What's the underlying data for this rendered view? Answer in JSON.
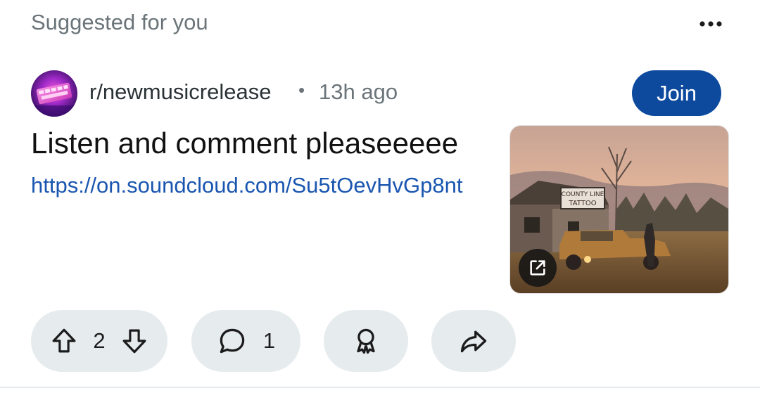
{
  "header": {
    "suggested_label": "Suggested for you",
    "more_icon": "more-horizontal-icon"
  },
  "post": {
    "subreddit": "r/newmusicrelease",
    "separator": "•",
    "time_ago": "13h ago",
    "join_label": "Join",
    "title": "Listen and comment pleaseeeee",
    "link": "https://on.soundcloud.com/Su5tOevHvGp8nt",
    "thumbnail_icon": "external-link-icon"
  },
  "actions": {
    "upvote_icon": "upvote-icon",
    "vote_count": "2",
    "downvote_icon": "downvote-icon",
    "comment_icon": "comment-icon",
    "comment_count": "1",
    "award_icon": "award-icon",
    "share_icon": "share-icon"
  },
  "colors": {
    "join_button": "#0d4a9e",
    "link": "#1a56b0",
    "pill_background": "#e6ebee",
    "muted_text": "#6a7479"
  }
}
